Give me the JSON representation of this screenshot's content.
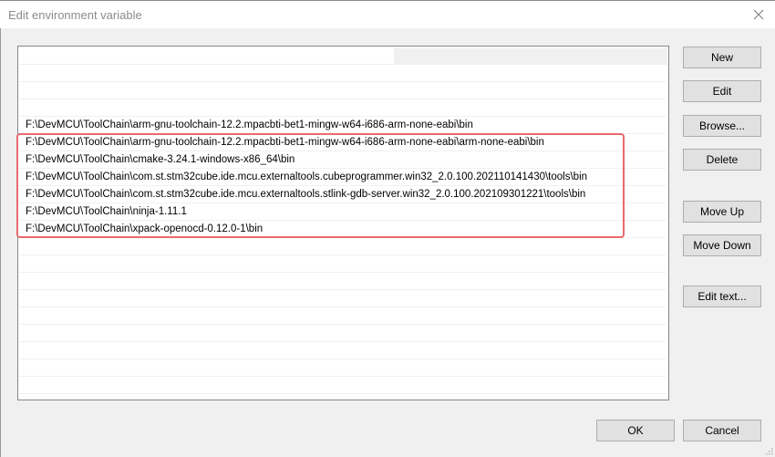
{
  "window": {
    "title": "Edit environment variable",
    "close_icon": "close-x-icon"
  },
  "list": {
    "rows": [
      "",
      "",
      "",
      "",
      "F:\\DevMCU\\ToolChain\\arm-gnu-toolchain-12.2.mpacbti-bet1-mingw-w64-i686-arm-none-eabi\\bin",
      "F:\\DevMCU\\ToolChain\\arm-gnu-toolchain-12.2.mpacbti-bet1-mingw-w64-i686-arm-none-eabi\\arm-none-eabi\\bin",
      "F:\\DevMCU\\ToolChain\\cmake-3.24.1-windows-x86_64\\bin",
      "F:\\DevMCU\\ToolChain\\com.st.stm32cube.ide.mcu.externaltools.cubeprogrammer.win32_2.0.100.202110141430\\tools\\bin",
      "F:\\DevMCU\\ToolChain\\com.st.stm32cube.ide.mcu.externaltools.stlink-gdb-server.win32_2.0.100.202109301221\\tools\\bin",
      "F:\\DevMCU\\ToolChain\\ninja-1.11.1",
      "F:\\DevMCU\\ToolChain\\xpack-openocd-0.12.0-1\\bin",
      "",
      "",
      "",
      "",
      "",
      "",
      "",
      "",
      ""
    ],
    "highlighted_rows": [
      4,
      5,
      6,
      7,
      8,
      9
    ],
    "highlight_color": "#ea6a6f"
  },
  "buttons": {
    "new": "New",
    "edit": "Edit",
    "browse": "Browse...",
    "delete": "Delete",
    "move_up": "Move Up",
    "move_down": "Move Down",
    "edit_text": "Edit text..."
  },
  "footer": {
    "ok": "OK",
    "cancel": "Cancel"
  }
}
